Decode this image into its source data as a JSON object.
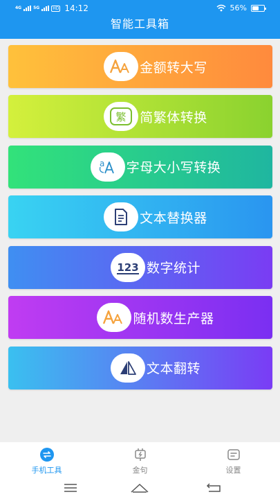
{
  "status_bar": {
    "net_left": "4G",
    "net_right": "5G",
    "hd_badge": "HD",
    "time": "14:12",
    "battery_text": "56%",
    "battery_level": 0.56
  },
  "header": {
    "title": "智能工具箱"
  },
  "tools": [
    {
      "label": "金额转大写",
      "icon": "letters-aa-icon",
      "gradient": [
        "#ffc13b",
        "#ff8a3d"
      ]
    },
    {
      "label": "简繁体转换",
      "icon": "traditional-char-icon",
      "gradient": [
        "#d4f03c",
        "#8ad22f"
      ]
    },
    {
      "label": "字母大小写转换",
      "icon": "case-convert-icon",
      "gradient": [
        "#32e27a",
        "#1fb6a0"
      ]
    },
    {
      "label": "文本替换器",
      "icon": "document-icon",
      "gradient": [
        "#39d3f2",
        "#2a95f0"
      ]
    },
    {
      "label": "数字统计",
      "icon": "number-123-icon",
      "gradient": [
        "#3f8ff2",
        "#7a3cf3"
      ]
    },
    {
      "label": "随机数生产器",
      "icon": "letters-aa-icon",
      "gradient": [
        "#c03cf2",
        "#7a2ff2"
      ]
    },
    {
      "label": "文本翻转",
      "icon": "flip-triangle-icon",
      "gradient": [
        "#3ac0f0",
        "#7a3cf5"
      ]
    }
  ],
  "icon_text": {
    "traditional": "繁",
    "numbers": "123"
  },
  "tabs": [
    {
      "label": "手机工具",
      "active": true
    },
    {
      "label": "金句",
      "active": false
    },
    {
      "label": "设置",
      "active": false
    }
  ],
  "colors": {
    "primary": "#1e96f0",
    "icon_orange": "#f5a23c",
    "icon_dark": "#2c3e75",
    "icon_green": "#7bbf2f"
  }
}
